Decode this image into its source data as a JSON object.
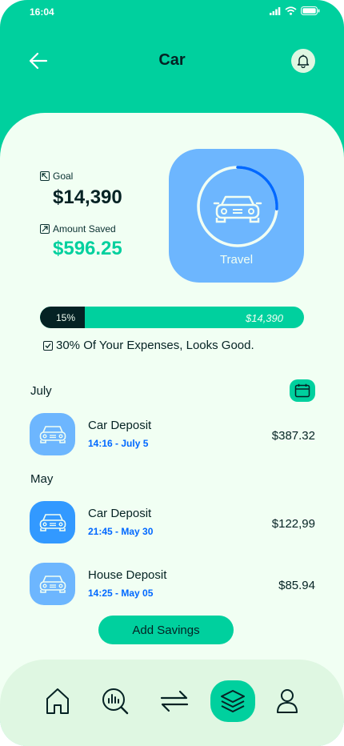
{
  "status": {
    "time": "16:04"
  },
  "header": {
    "title": "Car"
  },
  "summary": {
    "goal_label": "Goal",
    "goal_value": "$14,390",
    "saved_label": "Amount Saved",
    "saved_value": "$596.25"
  },
  "category_card": {
    "label": "Travel",
    "progress_fraction": 0.26
  },
  "progress": {
    "percent_label": "15%",
    "goal_label": "$14,390",
    "fill_fraction": 0.15
  },
  "expense_note": "30% Of Your Expenses, Looks Good.",
  "months": [
    {
      "label": "July",
      "transactions": [
        {
          "title": "Car Deposit",
          "time": "14:16 - July 5",
          "amount": "$387.32"
        }
      ]
    },
    {
      "label": "May",
      "transactions": [
        {
          "title": "Car Deposit",
          "time": "21:45 - May 30",
          "amount": "$122,99"
        },
        {
          "title": "House Deposit",
          "time": "14:25 - May 05",
          "amount": "$85.94"
        }
      ]
    }
  ],
  "add_button": {
    "label": "Add Savings"
  },
  "nav": [
    "home-icon",
    "analysis-icon",
    "transfer-icon",
    "layers-icon",
    "profile-icon"
  ],
  "colors": {
    "primary": "#00d09e",
    "background": "#f1fff3",
    "card_blue": "#6db6fe",
    "accent_blue": "#0068ff",
    "dark": "#052224"
  }
}
